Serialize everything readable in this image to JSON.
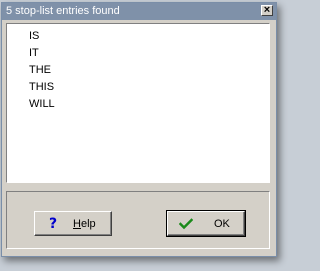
{
  "window": {
    "title": "5 stop-list entries found",
    "close_label": "×"
  },
  "entries": [
    "IS",
    "IT",
    "THE",
    "THIS",
    "WILL"
  ],
  "buttons": {
    "help": {
      "label": "Help",
      "icon": "help-question-icon"
    },
    "ok": {
      "label": "OK",
      "icon": "green-checkmark-icon"
    }
  },
  "colors": {
    "titlebar": "#7f91a9",
    "face": "#d4d0c8",
    "check": "#1a8a1a",
    "help_icon": "#0000cc"
  }
}
